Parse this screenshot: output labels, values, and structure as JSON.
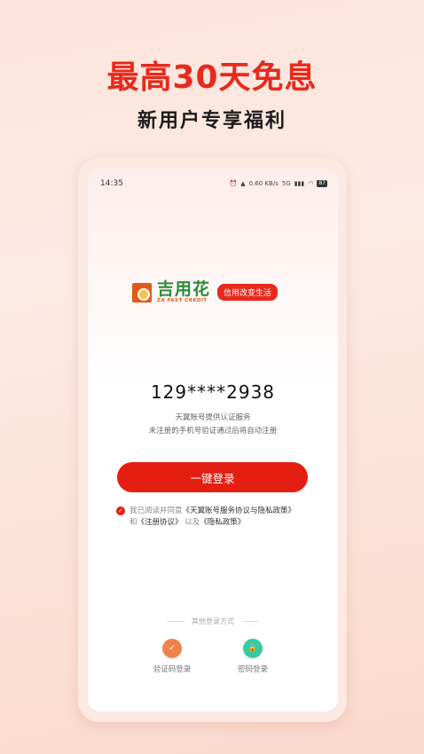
{
  "hero": {
    "title": "最高30天免息",
    "subtitle": "新用户专享福利"
  },
  "status_bar": {
    "time": "14:35",
    "network": "0.60 KB/s",
    "signal": "5G",
    "battery": "87"
  },
  "brand": {
    "name": "吉用花",
    "name_en": "ZA FAST CREDIT",
    "slogan": "信用改变生活"
  },
  "login": {
    "phone_number": "129****2938",
    "auth_provider_text": "天翼账号提供认证服务",
    "auto_register_text": "未注册的手机号验证通过后将自动注册",
    "one_click_label": "一键登录"
  },
  "agreement": {
    "prefix": "我已阅读并同意",
    "service_link": "《天翼账号服务协议与隐私政策》",
    "and": "和",
    "register_link": "《注册协议》",
    "and2": "以及",
    "privacy_link": "《隐私政策》"
  },
  "other_login": {
    "title": "其他登录方式",
    "sms_label": "验证码登录",
    "password_label": "密码登录"
  },
  "colors": {
    "accent": "#e51e12",
    "brand_green": "#2c8a3b",
    "sms_icon": "#f0834c",
    "password_icon": "#39c9a3"
  }
}
